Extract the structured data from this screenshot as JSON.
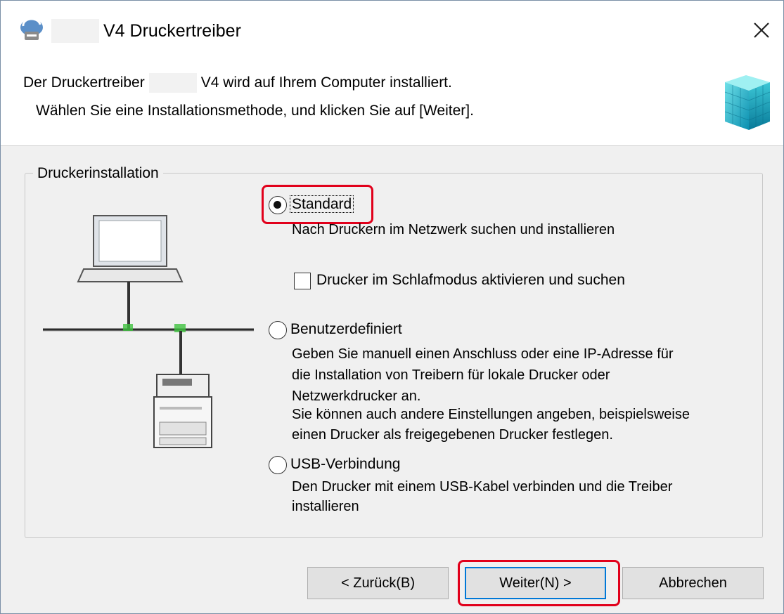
{
  "window": {
    "title": "V4 Druckertreiber",
    "close_glyph": "✕"
  },
  "header": {
    "line1_prefix": "Der Druckertreiber",
    "line1_suffix": "V4 wird auf Ihrem Computer installiert.",
    "line2": "Wählen Sie eine Installationsmethode, und klicken Sie auf [Weiter]."
  },
  "group": {
    "label": "Druckerinstallation",
    "options": [
      {
        "label": "Standard",
        "selected": true,
        "description": [
          "Nach Druckern im Netzwerk suchen und installieren"
        ],
        "checkbox": {
          "label": "Drucker im Schlafmodus aktivieren und suchen",
          "checked": false
        }
      },
      {
        "label": "Benutzerdefiniert",
        "selected": false,
        "description": [
          "Geben Sie manuell einen Anschluss oder eine IP-Adresse für",
          "die Installation von Treibern für lokale Drucker oder",
          "Netzwerkdrucker an.",
          "Sie können auch andere Einstellungen angeben, beispielsweise",
          "einen Drucker als freigegebenen Drucker festlegen."
        ]
      },
      {
        "label": "USB-Verbindung",
        "selected": false,
        "description": [
          "Den Drucker mit einem USB-Kabel verbinden und die Treiber",
          "installieren"
        ]
      }
    ]
  },
  "buttons": {
    "back": "< Zurück(B)",
    "next": "Weiter(N) >",
    "cancel": "Abbrechen"
  },
  "colors": {
    "highlight": "#e1001b",
    "focus_border": "#0078d7",
    "window_bg": "#f0f0f0",
    "network_accent": "#3fc23f"
  },
  "icons": [
    "printer-setup-icon",
    "close-icon",
    "canon-cube-logo",
    "laptop-icon",
    "network-line",
    "printer-icon"
  ]
}
